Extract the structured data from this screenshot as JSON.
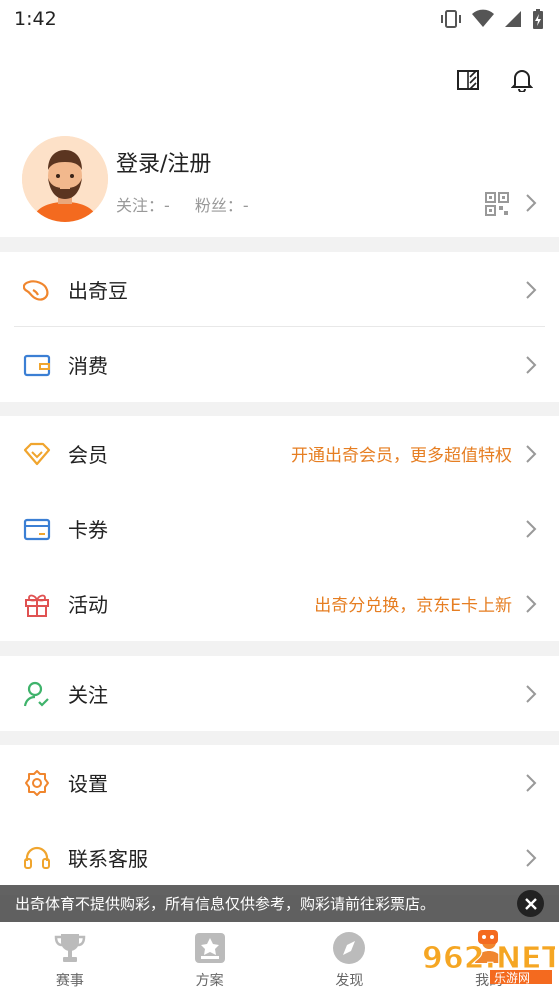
{
  "status_bar": {
    "time": "1:42"
  },
  "profile": {
    "name": "登录/注册",
    "following_label": "关注：-",
    "fans_label": "粉丝：-"
  },
  "menu": {
    "beans": "出奇豆",
    "consume": "消费",
    "member": "会员",
    "member_promo": "开通出奇会员，更多超值特权",
    "coupons": "卡券",
    "activity": "活动",
    "activity_promo": "出奇分兑换，京东E卡上新",
    "follow": "关注",
    "settings": "设置",
    "service": "联系客服"
  },
  "toast": {
    "message": "出奇体育不提供购彩，所有信息仅供参考，购彩请前往彩票店。"
  },
  "tabs": [
    {
      "label": "赛事",
      "icon": "trophy-icon"
    },
    {
      "label": "方案",
      "icon": "star-card-icon"
    },
    {
      "label": "发现",
      "icon": "compass-icon"
    },
    {
      "label": "我的",
      "icon": "profile-icon"
    }
  ],
  "watermark": {
    "text": "962.NET",
    "sub": "乐游网"
  },
  "colors": {
    "accent": "#e67e22",
    "icon_orange": "#f0862e",
    "icon_blue": "#3b7fd4",
    "icon_red": "#e05252",
    "icon_green": "#3fb36b"
  }
}
